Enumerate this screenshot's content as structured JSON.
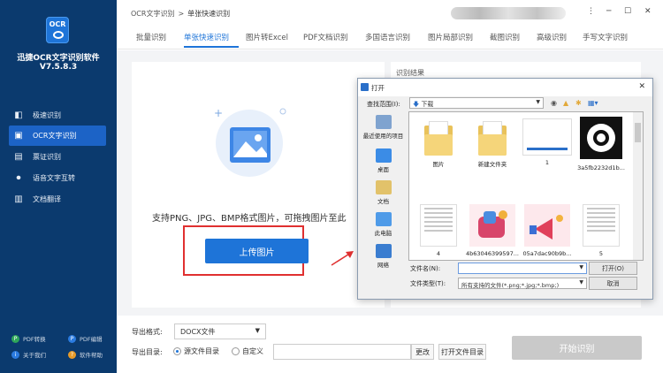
{
  "sidebar": {
    "logo_text": "OCR",
    "app_name": "迅捷OCR文字识别软件",
    "version": "V7.5.8.3",
    "items": [
      {
        "label": "极速识别",
        "icon": "lightning-icon"
      },
      {
        "label": "OCR文字识别",
        "icon": "ocr-icon"
      },
      {
        "label": "票证识别",
        "icon": "ticket-icon"
      },
      {
        "label": "语音文字互转",
        "icon": "microphone-icon"
      },
      {
        "label": "文档翻译",
        "icon": "translate-icon"
      }
    ],
    "footer": [
      {
        "label": "PDF转换"
      },
      {
        "label": "PDF编辑"
      },
      {
        "label": "关于我们"
      },
      {
        "label": "软件帮助"
      }
    ]
  },
  "breadcrumb": {
    "root": "OCR文字识别",
    "sep": ">",
    "current": "单张快速识别"
  },
  "window": {
    "min": "─",
    "max": "☐",
    "close": "✕",
    "menu": "⋮"
  },
  "tabs": [
    {
      "label": "批量识别"
    },
    {
      "label": "单张快速识别"
    },
    {
      "label": "图片转Excel"
    },
    {
      "label": "PDF文档识别"
    },
    {
      "label": "多国语言识别"
    },
    {
      "label": "图片局部识别"
    },
    {
      "label": "截图识别"
    },
    {
      "label": "高级识别"
    },
    {
      "label": "手写文字识别"
    }
  ],
  "main": {
    "upload_hint": "支持PNG、JPG、BMP格式图片，可拖拽图片至此",
    "upload_button": "上传图片",
    "result_title": "识别结果"
  },
  "bottom": {
    "export_format_label": "导出格式:",
    "export_format_value": "DOCX文件",
    "export_dir_label": "导出目录:",
    "radio_source": "源文件目录",
    "radio_custom": "自定义",
    "change_button": "更改",
    "open_folder_button": "打开文件目录",
    "start_button": "开始识别"
  },
  "dialog": {
    "title": "打开",
    "close": "✕",
    "lookin_label": "查找范围(I):",
    "lookin_value": "下载",
    "places": [
      {
        "label": "最近使用的项目"
      },
      {
        "label": "桌面"
      },
      {
        "label": "文档"
      },
      {
        "label": "此电脑"
      },
      {
        "label": "网络"
      }
    ],
    "files": [
      {
        "name": "图片"
      },
      {
        "name": "新建文件夹"
      },
      {
        "name": "1"
      },
      {
        "name": "3a5fb2232d1b..."
      },
      {
        "name": "4"
      },
      {
        "name": "4b63046399597..."
      },
      {
        "name": "05a7dac90b9b..."
      },
      {
        "name": "5"
      }
    ],
    "filename_label": "文件名(N):",
    "filetype_label": "文件类型(T):",
    "filetype_value": "所有支持的文件(*.png;*.jpg;*.bmp;)",
    "open_button": "打开(O)",
    "cancel_button": "取消"
  },
  "colors": {
    "sidebar": "#0b3a6e",
    "accent": "#1e74d8",
    "highlight": "#e03030"
  }
}
